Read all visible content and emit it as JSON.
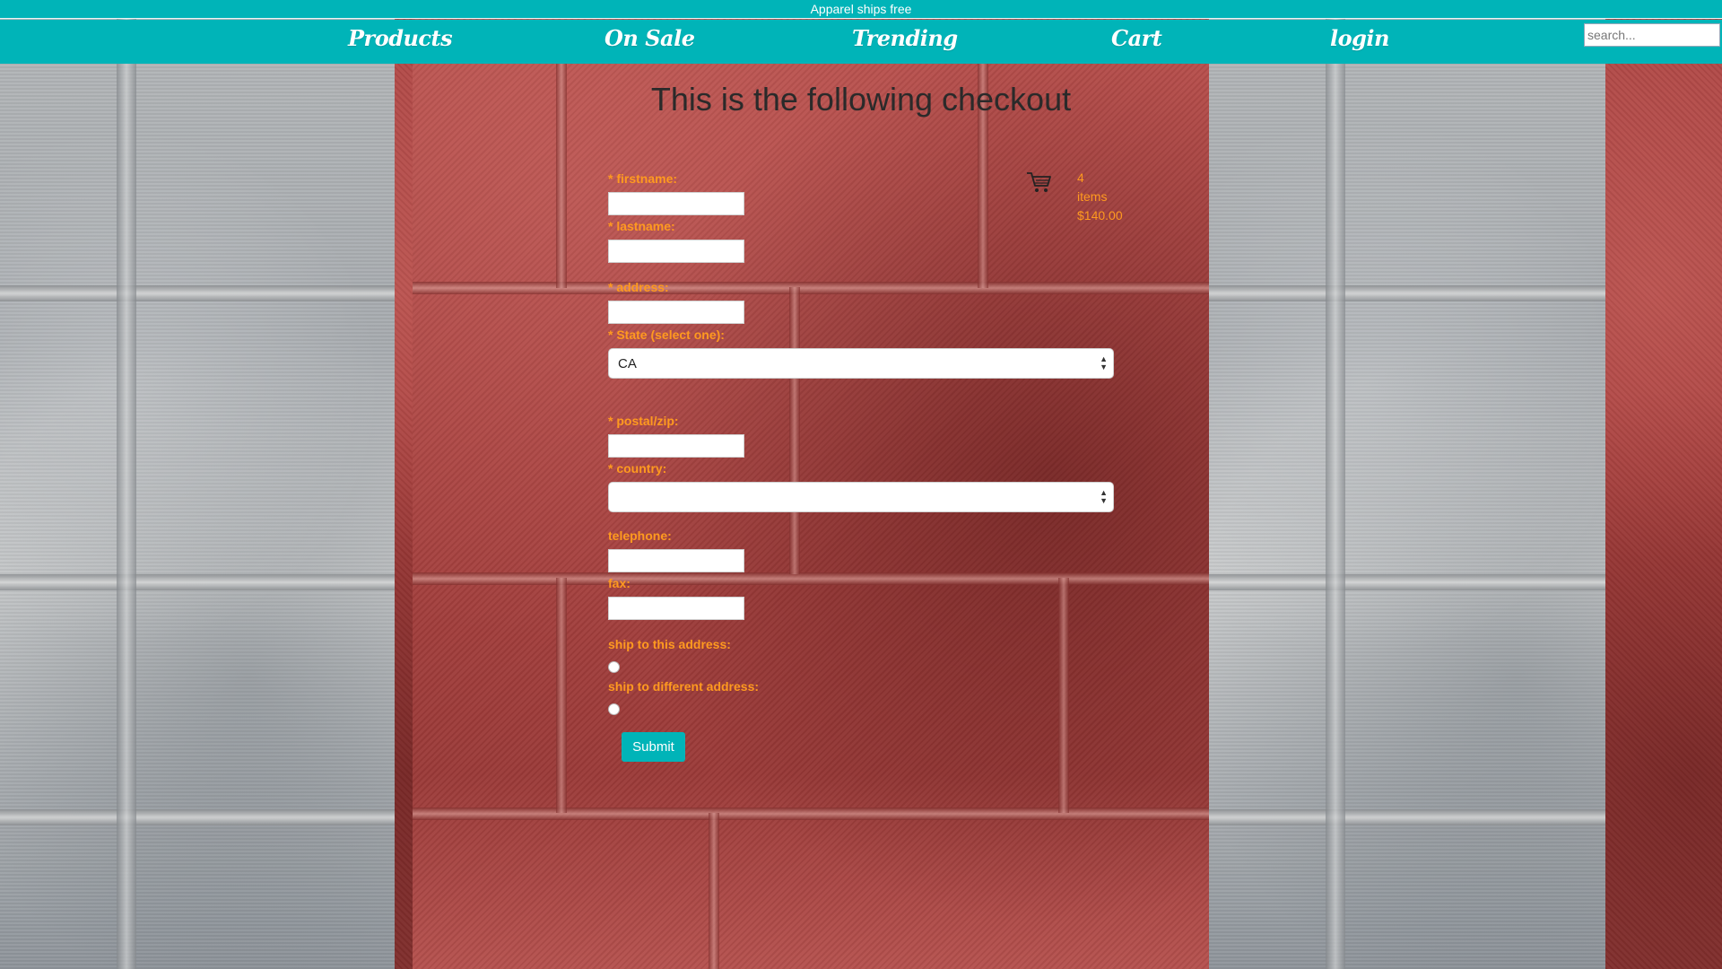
{
  "banner": {
    "text": "Apparel ships free"
  },
  "nav": {
    "items": [
      {
        "label": "Products"
      },
      {
        "label": "On Sale"
      },
      {
        "label": "Trending"
      },
      {
        "label": "Cart"
      },
      {
        "label": "login"
      }
    ],
    "search_placeholder": "search..."
  },
  "page": {
    "title": "This is the following checkout"
  },
  "form": {
    "firstname_label": "* firstname:",
    "lastname_label": "* lastname:",
    "address_label": "* address:",
    "state_label": "* State (select one):",
    "state_value": "CA",
    "postal_label": "* postal/zip:",
    "country_label": "* country:",
    "country_value": "",
    "telephone_label": "telephone:",
    "fax_label": "fax:",
    "ship_this_label": "ship to this address:",
    "ship_different_label": "ship to different address:",
    "submit_label": "Submit"
  },
  "cart": {
    "count": "4",
    "items_label": "items",
    "total": "$140.00"
  },
  "colors": {
    "accent": "#00b4b8",
    "label": "#ff9a1f",
    "title": "#2a2a2a"
  },
  "icons": {
    "cart": "shopping-cart-icon",
    "select_arrows": "up-down-arrows-icon"
  }
}
